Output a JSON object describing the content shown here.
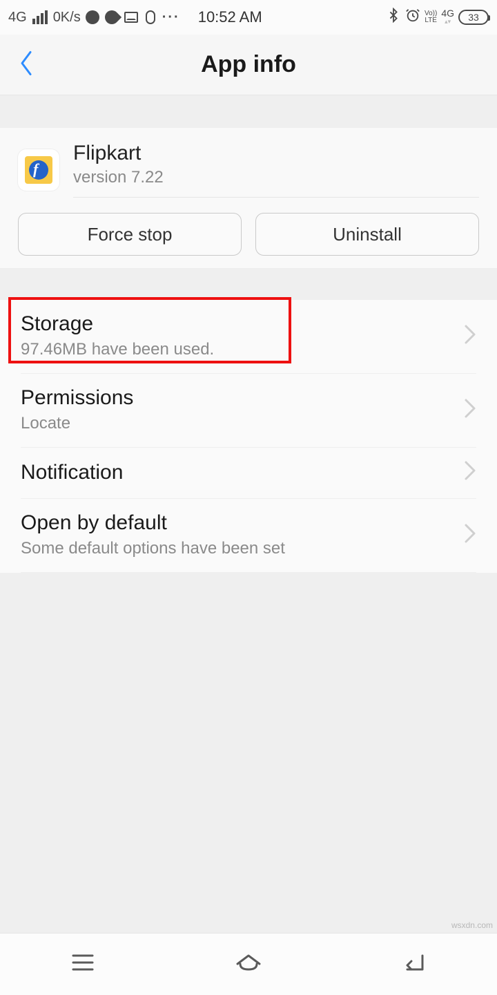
{
  "status": {
    "net_label": "4G",
    "speed": "0K/s",
    "time": "10:52 AM",
    "volte_top": "Vo))",
    "volte_bot": "LTE",
    "net2_top": "4G",
    "battery": "33"
  },
  "header": {
    "title": "App info"
  },
  "app": {
    "name": "Flipkart",
    "version": "version 7.22",
    "force_stop": "Force stop",
    "uninstall": "Uninstall"
  },
  "rows": {
    "storage": {
      "title": "Storage",
      "sub": "97.46MB have been used."
    },
    "permissions": {
      "title": "Permissions",
      "sub": "Locate"
    },
    "notification": {
      "title": "Notification"
    },
    "open_default": {
      "title": "Open by default",
      "sub": "Some default options have been set"
    }
  },
  "watermark": "wsxdn.com"
}
